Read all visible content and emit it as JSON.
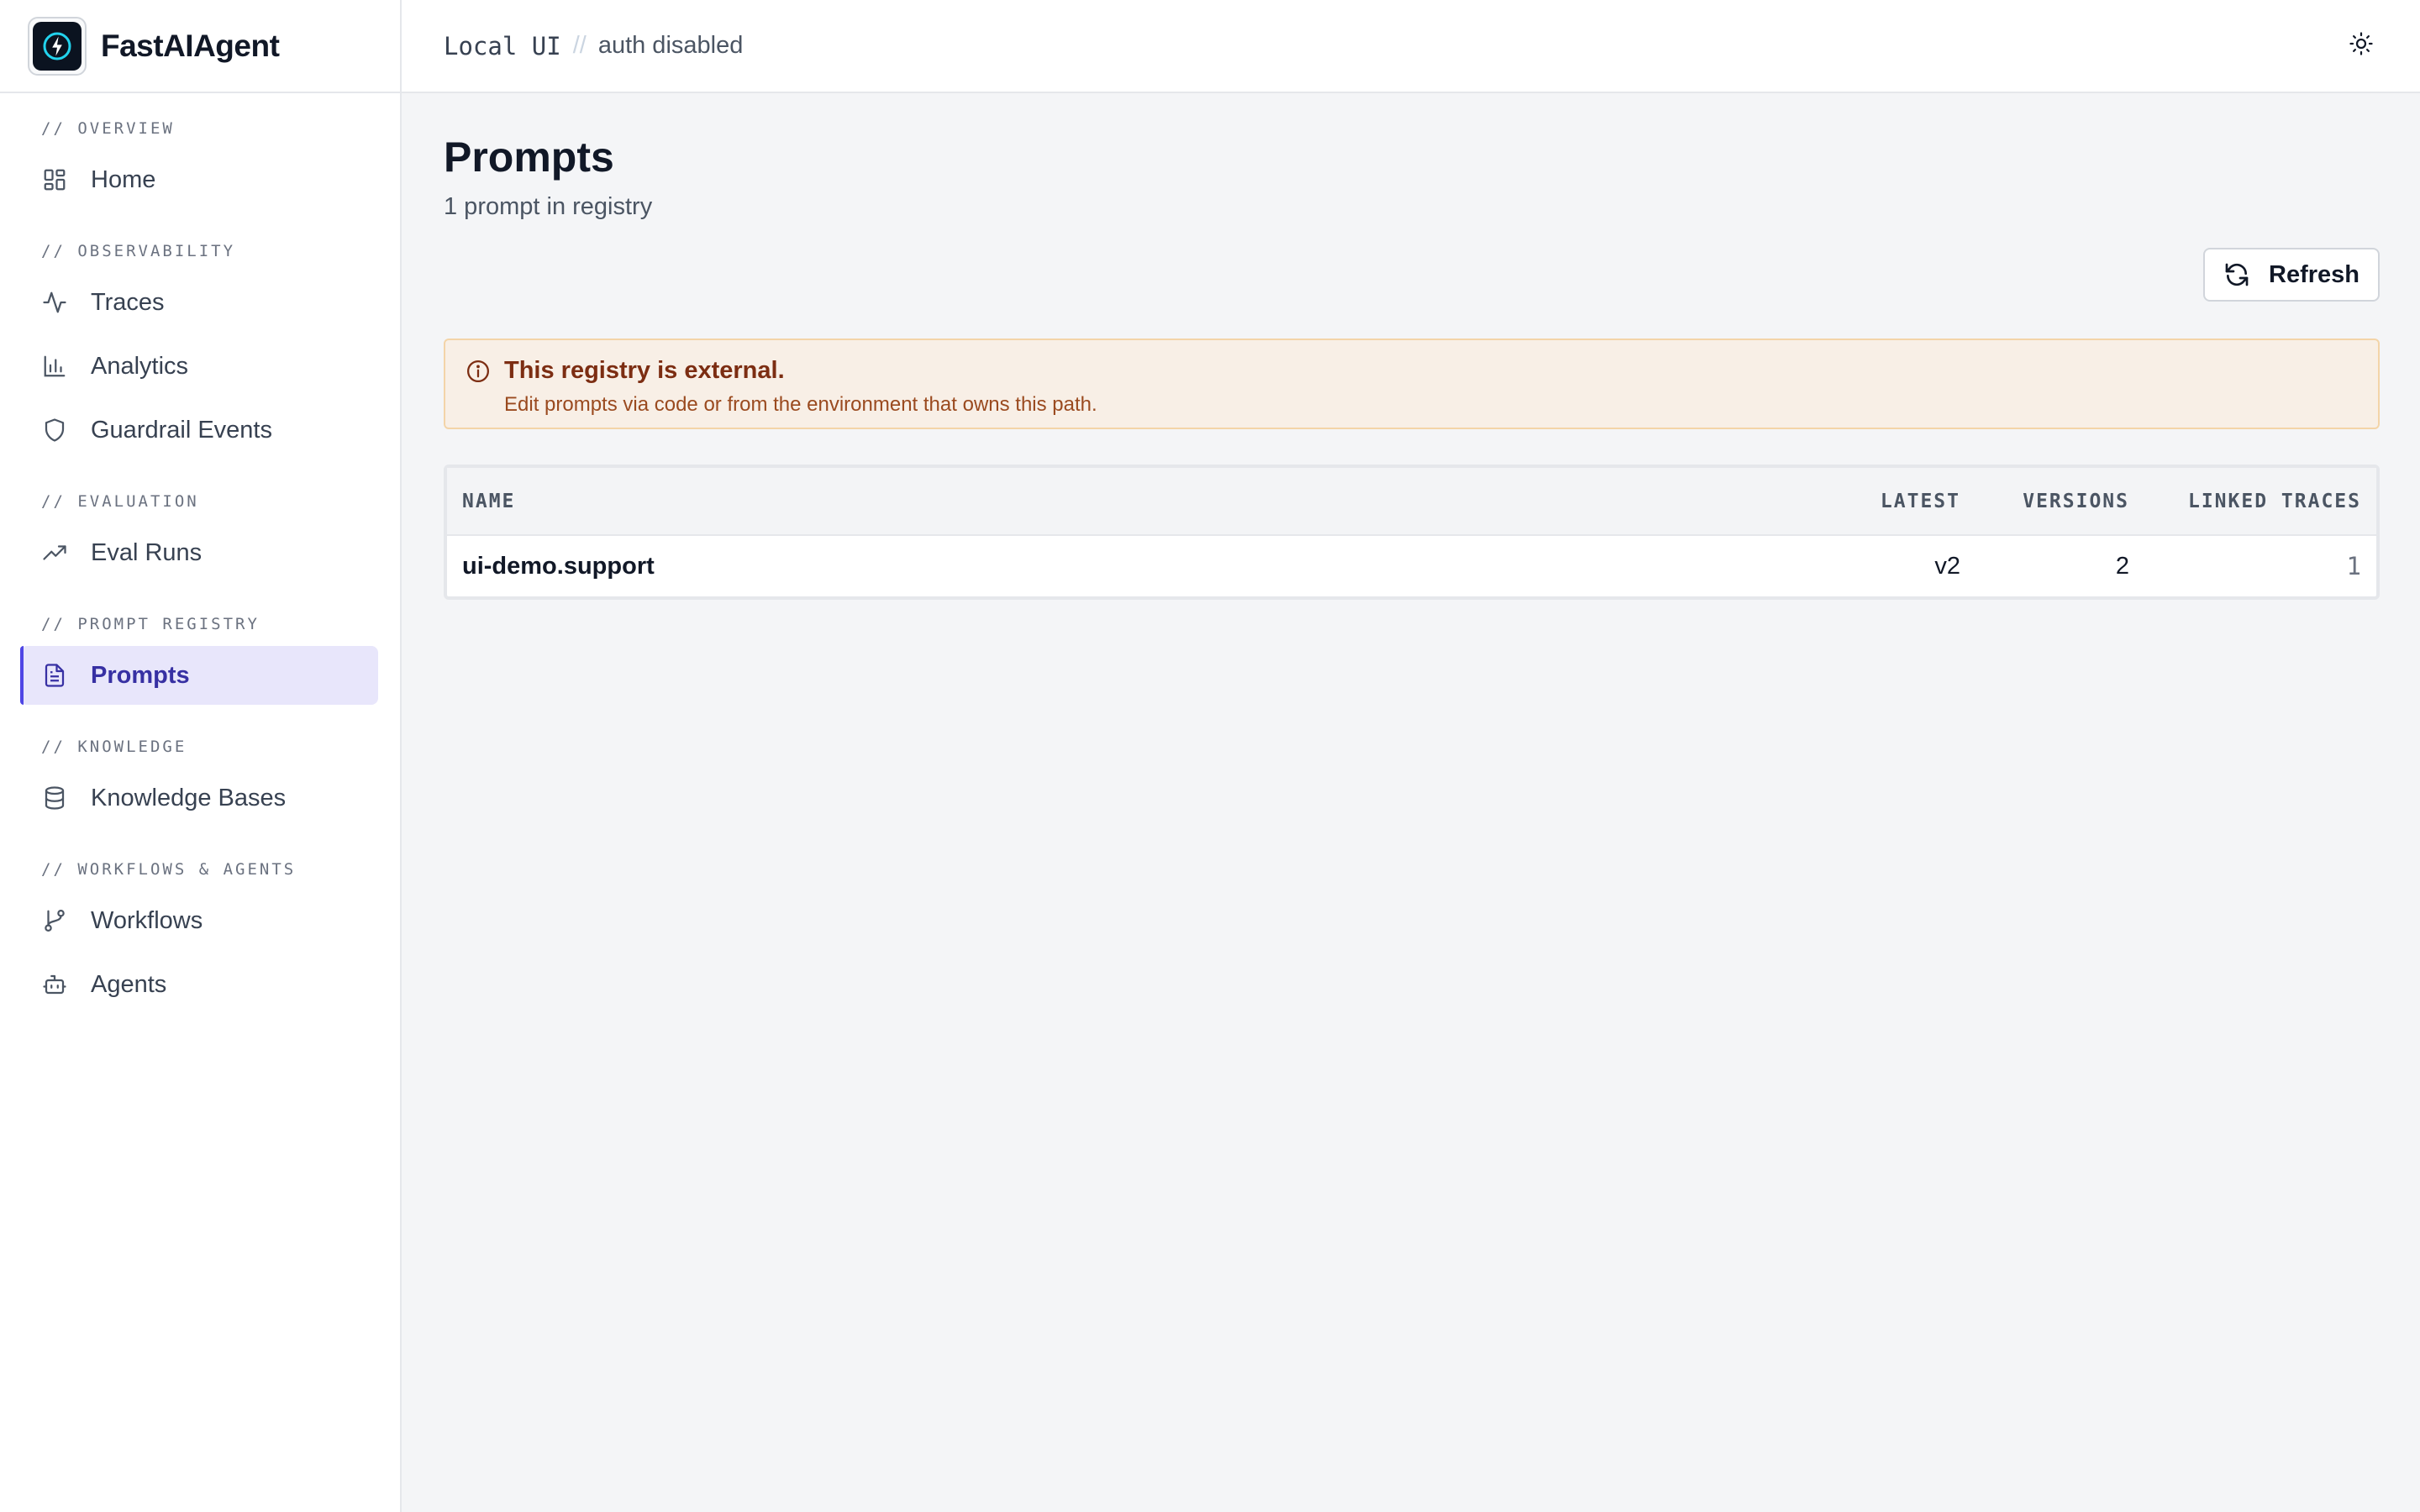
{
  "brand": {
    "name": "FastAIAgent"
  },
  "sidebar": {
    "sections": [
      {
        "label": "// OVERVIEW",
        "items": [
          {
            "label": "Home",
            "icon": "grid-icon"
          }
        ]
      },
      {
        "label": "// OBSERVABILITY",
        "items": [
          {
            "label": "Traces",
            "icon": "activity-icon"
          },
          {
            "label": "Analytics",
            "icon": "bar-chart-icon"
          },
          {
            "label": "Guardrail Events",
            "icon": "shield-icon"
          }
        ]
      },
      {
        "label": "// EVALUATION",
        "items": [
          {
            "label": "Eval Runs",
            "icon": "trending-up-icon"
          }
        ]
      },
      {
        "label": "// PROMPT REGISTRY",
        "items": [
          {
            "label": "Prompts",
            "icon": "document-icon",
            "active": true
          }
        ]
      },
      {
        "label": "// KNOWLEDGE",
        "items": [
          {
            "label": "Knowledge Bases",
            "icon": "database-icon"
          }
        ]
      },
      {
        "label": "// WORKFLOWS & AGENTS",
        "items": [
          {
            "label": "Workflows",
            "icon": "git-branch-icon"
          },
          {
            "label": "Agents",
            "icon": "bot-icon"
          }
        ]
      }
    ]
  },
  "topbar": {
    "crumb_1": "Local UI",
    "separator": "//",
    "crumb_2": "auth disabled",
    "theme_icon": "sun-icon"
  },
  "page": {
    "title": "Prompts",
    "subtitle": "1 prompt in registry",
    "refresh_label": "Refresh"
  },
  "alert": {
    "title": "This registry is external.",
    "body": "Edit prompts via code or from the environment that owns this path."
  },
  "table": {
    "headers": {
      "name": "NAME",
      "latest": "LATEST",
      "versions": "VERSIONS",
      "linked": "LINKED TRACES"
    },
    "rows": [
      {
        "name": "ui-demo.support",
        "latest": "v2",
        "versions": "2",
        "linked": "1"
      }
    ]
  },
  "colors": {
    "accent": "#4f46e5",
    "active_bg": "#e8e6fb",
    "alert_bg": "#f8efe6",
    "alert_border": "#f3d4a8"
  }
}
